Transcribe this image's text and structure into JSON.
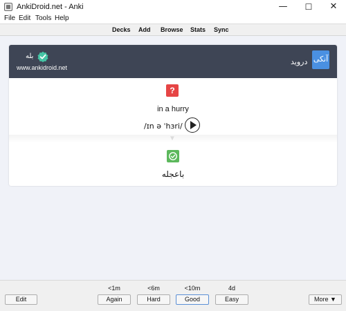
{
  "window": {
    "title": "AnkiDroid.net - Anki",
    "minimize": "—",
    "maximize": "☐",
    "close": "✕"
  },
  "menu": [
    "File",
    "Edit",
    "Tools",
    "Help"
  ],
  "deck_nav": [
    "Decks",
    "Add",
    "Browse",
    "Stats",
    "Sync"
  ],
  "card": {
    "header": {
      "yes_text": "بله",
      "site": "www.ankidroid.net",
      "droid_text": "درويد",
      "anki_text": "آنکی"
    },
    "question_icon": "?",
    "word": "in a hurry",
    "phonetic": "/ɪn ə ˈhɜri/",
    "answer": "باعجله"
  },
  "answer_bar": {
    "edit_label": "Edit",
    "more_label": "More ▼",
    "ease_buttons": [
      {
        "interval": "<1m",
        "label": "Again"
      },
      {
        "interval": "<6m",
        "label": "Hard"
      },
      {
        "interval": "<10m",
        "label": "Good"
      },
      {
        "interval": "4d",
        "label": "Easy"
      }
    ]
  },
  "colors": {
    "header_bg": "#3e4555",
    "anki_tile": "#4a90e2",
    "question_red": "#e64545",
    "check_green": "#5cb85c",
    "badge_teal": "#45c4a5",
    "content_bg": "#f0f2f8"
  }
}
